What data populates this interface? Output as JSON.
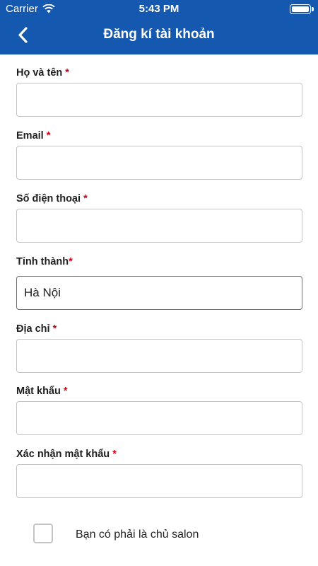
{
  "status_bar": {
    "carrier": "Carrier",
    "time": "5:43 PM"
  },
  "header": {
    "title": "Đăng kí tài khoản"
  },
  "form": {
    "full_name": {
      "label": "Họ và tên",
      "required_mark": "*",
      "value": ""
    },
    "email": {
      "label": "Email",
      "required_mark": "*",
      "value": ""
    },
    "phone": {
      "label": "Số điện thoại",
      "required_mark": "*",
      "value": ""
    },
    "province": {
      "label": "Tỉnh thành",
      "required_mark": "*",
      "value": "Hà Nội"
    },
    "address": {
      "label": "Địa chỉ",
      "required_mark": "*",
      "value": ""
    },
    "password": {
      "label": "Mật khẩu",
      "required_mark": "*",
      "value": ""
    },
    "confirm_password": {
      "label": "Xác nhận mật khẩu",
      "required_mark": "*",
      "value": ""
    },
    "salon_owner_checkbox": {
      "label": "Bạn có phải là chủ salon",
      "checked": false
    }
  },
  "colors": {
    "header_bg": "#1558b0",
    "required": "#d0021b",
    "border": "#c4c4c4"
  }
}
